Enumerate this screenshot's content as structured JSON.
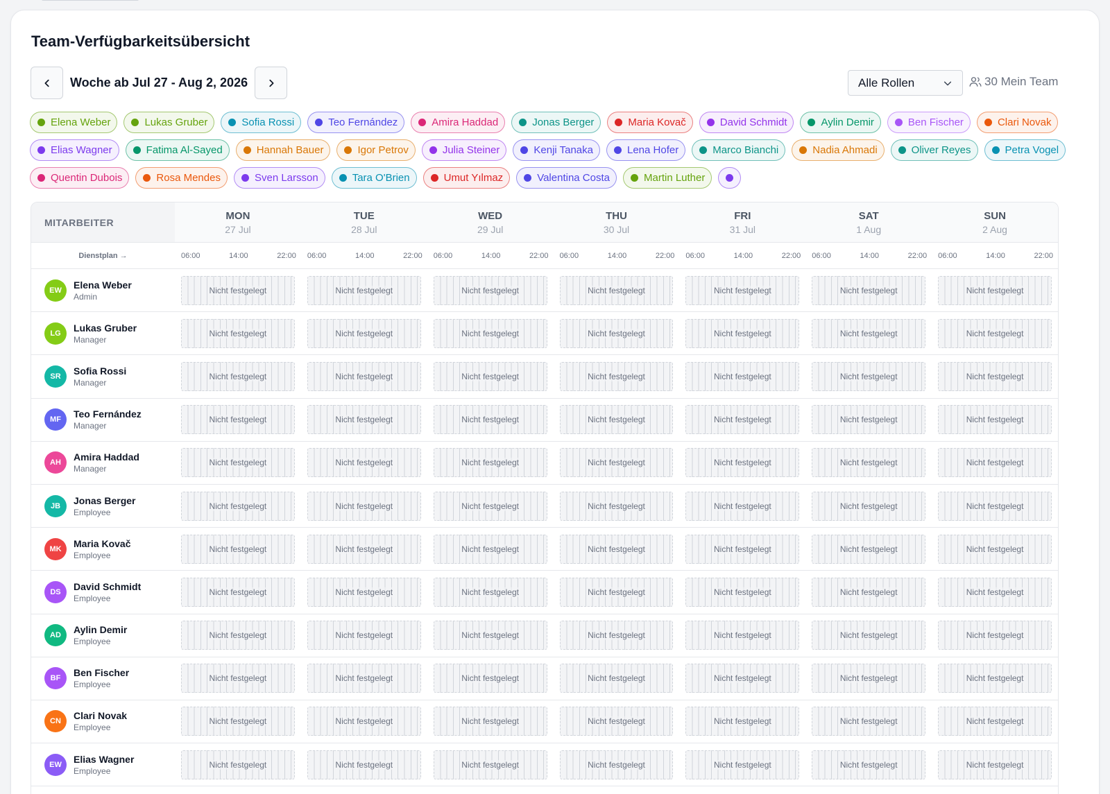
{
  "title": "Team-Verfügbarkeitsübersicht",
  "week_label": "Woche ab Jul 27 - Aug 2, 2026",
  "role_filter": {
    "selected": "Alle Rollen"
  },
  "team_count": {
    "label": "30 Mein Team"
  },
  "chips": [
    {
      "name": "Elena Weber",
      "color": "#65a30d"
    },
    {
      "name": "Lukas Gruber",
      "color": "#65a30d"
    },
    {
      "name": "Sofia Rossi",
      "color": "#0891b2"
    },
    {
      "name": "Teo Fernández",
      "color": "#4f46e5"
    },
    {
      "name": "Amira Haddad",
      "color": "#db2777"
    },
    {
      "name": "Jonas Berger",
      "color": "#0d9488"
    },
    {
      "name": "Maria Kovač",
      "color": "#dc2626"
    },
    {
      "name": "David Schmidt",
      "color": "#9333ea"
    },
    {
      "name": "Aylin Demir",
      "color": "#059669"
    },
    {
      "name": "Ben Fischer",
      "color": "#a855f7"
    },
    {
      "name": "Clari Novak",
      "color": "#ea580c"
    },
    {
      "name": "Elias Wagner",
      "color": "#7c3aed"
    },
    {
      "name": "Fatima Al-Sayed",
      "color": "#059669"
    },
    {
      "name": "Hannah Bauer",
      "color": "#d97706"
    },
    {
      "name": "Igor Petrov",
      "color": "#d97706"
    },
    {
      "name": "Julia Steiner",
      "color": "#9333ea"
    },
    {
      "name": "Kenji Tanaka",
      "color": "#4f46e5"
    },
    {
      "name": "Lena Hofer",
      "color": "#4f46e5"
    },
    {
      "name": "Marco Bianchi",
      "color": "#0d9488"
    },
    {
      "name": "Nadia Ahmadi",
      "color": "#d97706"
    },
    {
      "name": "Oliver Reyes",
      "color": "#0d9488"
    },
    {
      "name": "Petra Vogel",
      "color": "#0891b2"
    },
    {
      "name": "Quentin Dubois",
      "color": "#db2777"
    },
    {
      "name": "Rosa Mendes",
      "color": "#ea580c"
    },
    {
      "name": "Sven Larsson",
      "color": "#7c3aed"
    },
    {
      "name": "Tara O'Brien",
      "color": "#0891b2"
    },
    {
      "name": "Umut Yılmaz",
      "color": "#dc2626"
    },
    {
      "name": "Valentina Costa",
      "color": "#4f46e5"
    },
    {
      "name": "Martin Luther",
      "color": "#65a30d"
    },
    {
      "name": "",
      "color": "#7c3aed"
    }
  ],
  "grid": {
    "employee_header": "MITARBEITER",
    "scale_label": "Dienstplan →",
    "scale_ticks": [
      "06:00",
      "14:00",
      "22:00"
    ],
    "slot_label": "Nicht festgelegt",
    "days": [
      {
        "name": "MON",
        "date": "27 Jul"
      },
      {
        "name": "TUE",
        "date": "28 Jul"
      },
      {
        "name": "WED",
        "date": "29 Jul"
      },
      {
        "name": "THU",
        "date": "30 Jul"
      },
      {
        "name": "FRI",
        "date": "31 Jul"
      },
      {
        "name": "SAT",
        "date": "1 Aug"
      },
      {
        "name": "SUN",
        "date": "2 Aug"
      }
    ],
    "employees": [
      {
        "initials": "EW",
        "name": "Elena Weber",
        "role": "Admin",
        "color": "#84cc16"
      },
      {
        "initials": "LG",
        "name": "Lukas Gruber",
        "role": "Manager",
        "color": "#84cc16"
      },
      {
        "initials": "SR",
        "name": "Sofia Rossi",
        "role": "Manager",
        "color": "#14b8a6"
      },
      {
        "initials": "MF",
        "name": "Teo Fernández",
        "role": "Manager",
        "color": "#6366f1"
      },
      {
        "initials": "AH",
        "name": "Amira Haddad",
        "role": "Manager",
        "color": "#ec4899"
      },
      {
        "initials": "JB",
        "name": "Jonas Berger",
        "role": "Employee",
        "color": "#14b8a6"
      },
      {
        "initials": "MK",
        "name": "Maria Kovač",
        "role": "Employee",
        "color": "#ef4444"
      },
      {
        "initials": "DS",
        "name": "David Schmidt",
        "role": "Employee",
        "color": "#a855f7"
      },
      {
        "initials": "AD",
        "name": "Aylin Demir",
        "role": "Employee",
        "color": "#10b981"
      },
      {
        "initials": "BF",
        "name": "Ben Fischer",
        "role": "Employee",
        "color": "#a855f7"
      },
      {
        "initials": "CN",
        "name": "Clari Novak",
        "role": "Employee",
        "color": "#f97316"
      },
      {
        "initials": "EW",
        "name": "Elias Wagner",
        "role": "Employee",
        "color": "#8b5cf6"
      }
    ]
  }
}
